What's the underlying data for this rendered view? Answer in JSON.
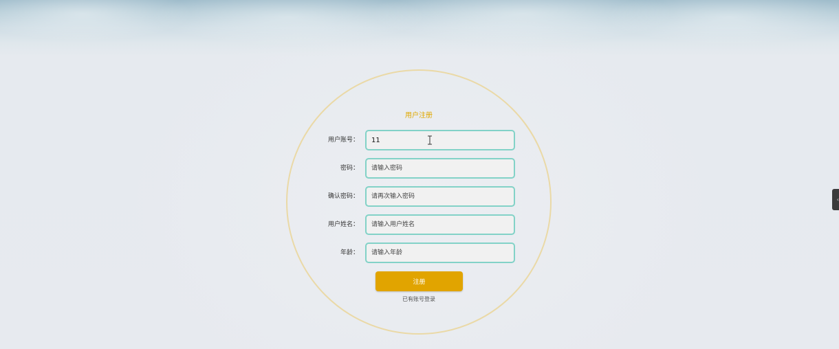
{
  "form": {
    "title": "用户注册",
    "fields": [
      {
        "label": "用户账号：",
        "value": "11",
        "placeholder": ""
      },
      {
        "label": "密码：",
        "value": "",
        "placeholder": "请输入密码"
      },
      {
        "label": "确认密码：",
        "value": "",
        "placeholder": "请再次输入密码"
      },
      {
        "label": "用户姓名：",
        "value": "",
        "placeholder": "请输入用户姓名"
      },
      {
        "label": "年龄：",
        "value": "",
        "placeholder": "请输入年龄"
      }
    ],
    "submit_label": "注册",
    "login_link": "已有账号登录"
  },
  "side_tab": {
    "icon": "chevron-left-icon"
  },
  "colors": {
    "accent": "#e1a400",
    "input_border": "#82d2c7",
    "circle_border": "#ead9a6"
  }
}
